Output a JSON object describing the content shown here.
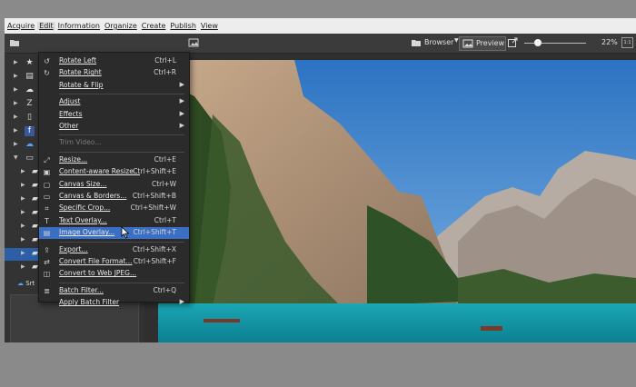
{
  "menubar": {
    "items": [
      "Acquire",
      "Edit",
      "Information",
      "Organize",
      "Create",
      "Publish",
      "View"
    ],
    "active_index": 1
  },
  "toolbar": {
    "browser_label": "Browser",
    "preview_label": "Preview",
    "zoom_label": "22%",
    "zoom_fraction": 0.22,
    "icons": {
      "browser": "folder-icon",
      "preview": "image-icon",
      "external": "open-external-icon",
      "fit": "fit-window-icon"
    }
  },
  "edit_menu": {
    "items": [
      {
        "label": "Rotate Left",
        "shortcut": "Ctrl+L",
        "icon": "rotate-left-icon"
      },
      {
        "label": "Rotate Right",
        "shortcut": "Ctrl+R",
        "icon": "rotate-right-icon"
      },
      {
        "label": "Rotate & Flip",
        "submenu": true
      },
      {
        "separator": true
      },
      {
        "label": "Adjust",
        "submenu": true
      },
      {
        "label": "Effects",
        "submenu": true
      },
      {
        "label": "Other",
        "submenu": true
      },
      {
        "separator": true
      },
      {
        "label": "Trim Video...",
        "disabled": true
      },
      {
        "separator": true
      },
      {
        "label": "Resize...",
        "shortcut": "Ctrl+E",
        "icon": "resize-icon"
      },
      {
        "label": "Content-aware Resize...",
        "shortcut": "Ctrl+Shift+E",
        "icon": "content-aware-icon"
      },
      {
        "label": "Canvas Size...",
        "shortcut": "Ctrl+W",
        "icon": "canvas-size-icon"
      },
      {
        "label": "Canvas & Borders...",
        "shortcut": "Ctrl+Shift+B",
        "icon": "canvas-borders-icon"
      },
      {
        "label": "Specific Crop...",
        "shortcut": "Ctrl+Shift+W",
        "icon": "crop-icon"
      },
      {
        "label": "Text Overlay...",
        "shortcut": "Ctrl+T",
        "icon": "text-overlay-icon"
      },
      {
        "label": "Image Overlay...",
        "shortcut": "Ctrl+Shift+T",
        "icon": "image-overlay-icon",
        "highlighted": true
      },
      {
        "separator": true
      },
      {
        "label": "Export...",
        "shortcut": "Ctrl+Shift+X",
        "icon": "export-icon"
      },
      {
        "label": "Convert File Format...",
        "shortcut": "Ctrl+Shift+F",
        "icon": "convert-icon"
      },
      {
        "label": "Convert to Web JPEG...",
        "icon": "web-jpeg-icon"
      },
      {
        "separator": true
      },
      {
        "label": "Batch Filter...",
        "shortcut": "Ctrl+Q",
        "icon": "batch-filter-icon"
      },
      {
        "label": "Apply Batch Filter",
        "submenu": true
      }
    ]
  },
  "left_panel": {
    "tree_icons": [
      "star-icon",
      "document-icon",
      "cloud-icon",
      "z-app-icon",
      "phone-icon",
      "facebook-icon",
      "cloud-drive-icon",
      "monitor-icon",
      "folder-icon",
      "folder-icon",
      "folder-icon",
      "folder-icon",
      "folder-icon",
      "folder-icon",
      "folder-icon",
      "folder-icon"
    ],
    "selected_row": 14,
    "partial_label": "Srt"
  },
  "colors": {
    "accent": "#3a6fc4",
    "menu_bg": "#2b2b2b",
    "menubar_bg": "#ededed"
  }
}
